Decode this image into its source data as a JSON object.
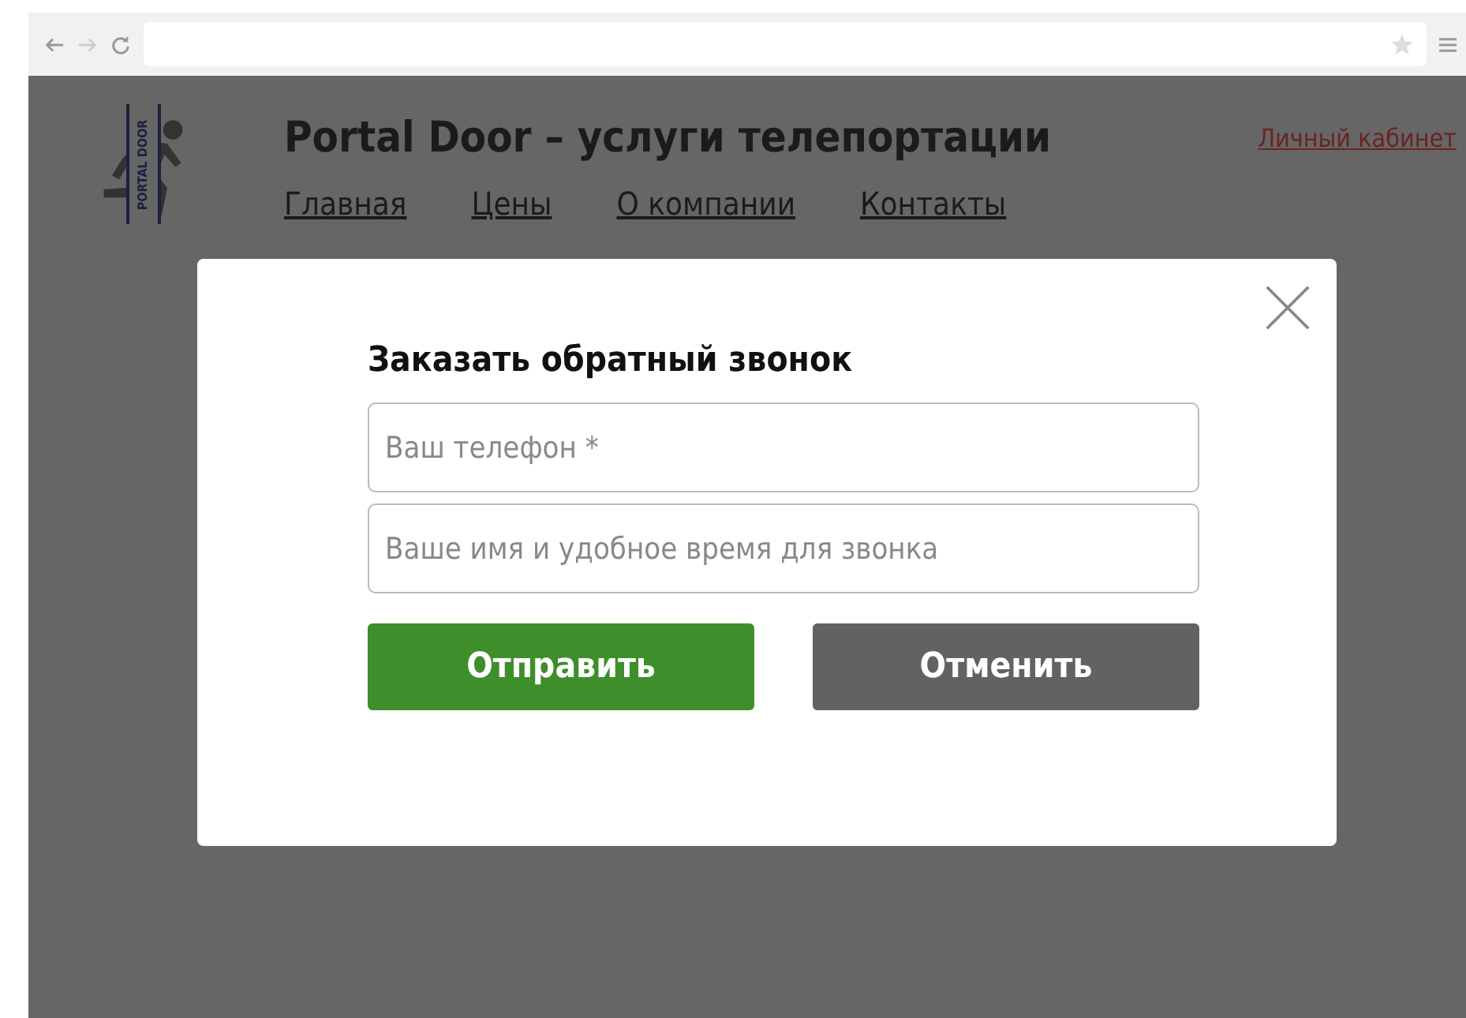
{
  "header": {
    "logo_text": "PORTAL DOOR",
    "title": "Portal Door – услуги телепортации",
    "account_link": "Личный кабинет"
  },
  "nav": [
    {
      "label": "Главная"
    },
    {
      "label": "Цены"
    },
    {
      "label": "О компании"
    },
    {
      "label": "Контакты"
    }
  ],
  "modal": {
    "title": "Заказать обратный звонок",
    "fields": [
      {
        "placeholder": "Ваш телефон *"
      },
      {
        "placeholder": "Ваше имя и удобное время для звонка"
      }
    ],
    "buttons": [
      {
        "label": "Отправить",
        "kind": "primary"
      },
      {
        "label": "Отменить",
        "kind": "secondary"
      }
    ]
  }
}
